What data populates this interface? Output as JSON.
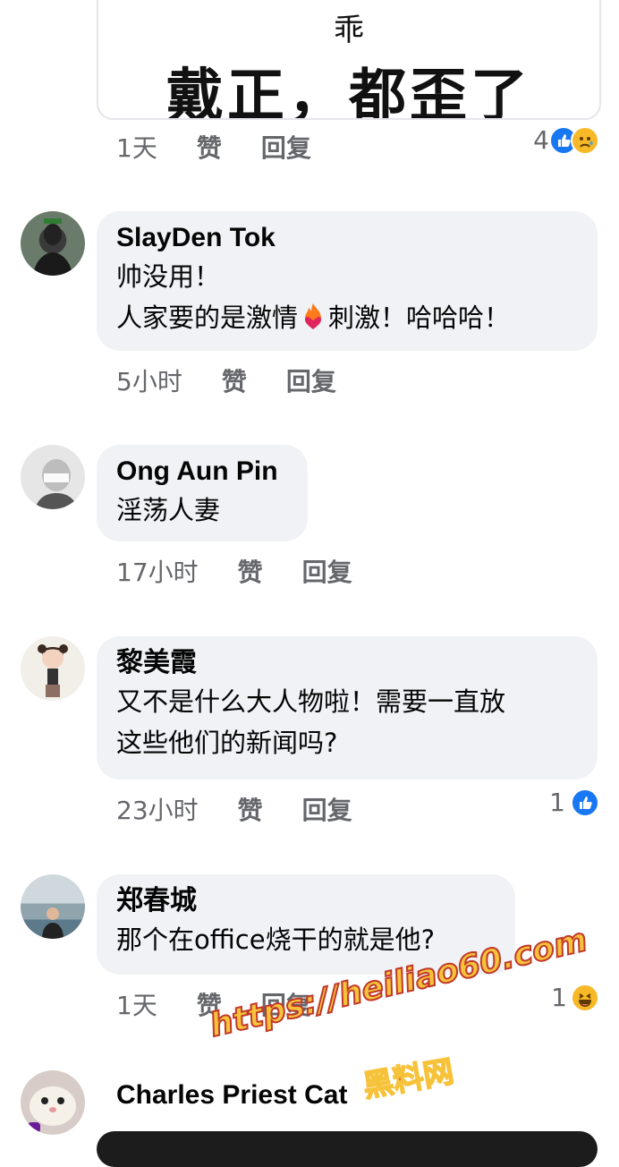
{
  "top_post": {
    "image_text_small": "乖",
    "image_text_big": "戴正，都歪了",
    "time": "1天",
    "like_label": "赞",
    "reply_label": "回复",
    "reaction_count": "4"
  },
  "comments": [
    {
      "name": "SlayDen Tok",
      "line1": "帅没用！",
      "line2_a": "人家要的是激情",
      "line2_b": "刺激！哈哈哈！",
      "time": "5小时",
      "like_label": "赞",
      "reply_label": "回复"
    },
    {
      "name": "Ong Aun Pin",
      "line1": "淫荡人妻",
      "time": "17小时",
      "like_label": "赞",
      "reply_label": "回复"
    },
    {
      "name": "黎美霞",
      "line1": "又不是什么大人物啦！需要一直放",
      "line2": "这些他们的新闻吗?",
      "time": "23小时",
      "like_label": "赞",
      "reply_label": "回复",
      "reaction_count": "1"
    },
    {
      "name": "郑春城",
      "line1": "那个在office烧干的就是他?",
      "time": "1天",
      "like_label": "赞",
      "reply_label": "回复",
      "reaction_count": "1"
    },
    {
      "name": "Charles Priest Cat"
    }
  ],
  "watermark": {
    "url": "https://heiliao60.com",
    "label": "黑料网"
  },
  "colors": {
    "like_blue": "#1877f2",
    "bubble_bg": "#f0f2f5",
    "meta_gray": "#65676b"
  }
}
